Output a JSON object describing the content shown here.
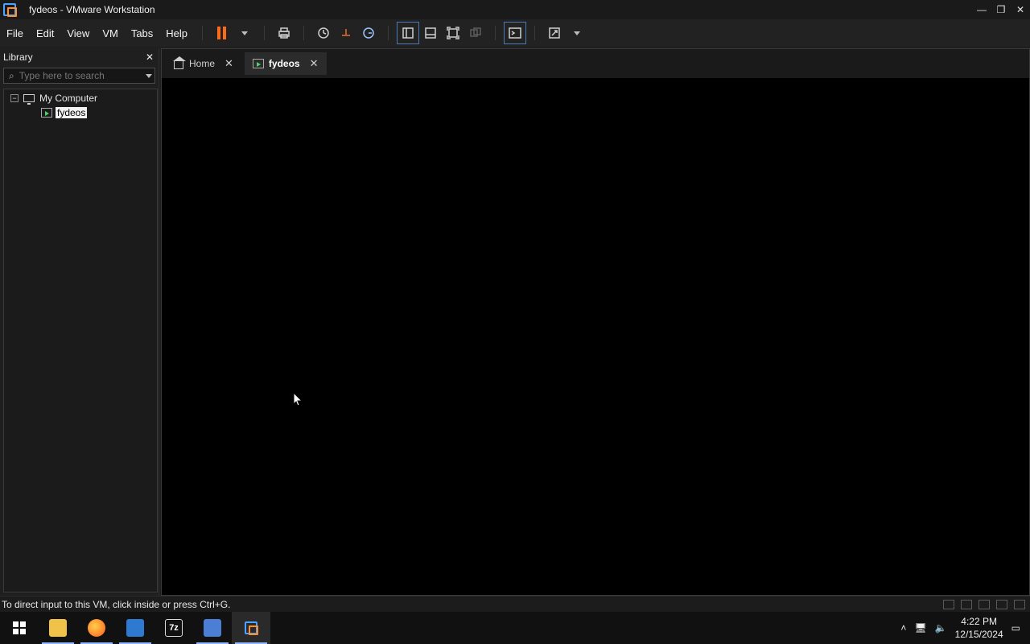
{
  "window": {
    "title": "fydeos - VMware Workstation"
  },
  "menu": {
    "items": [
      "File",
      "Edit",
      "View",
      "VM",
      "Tabs",
      "Help"
    ]
  },
  "library": {
    "title": "Library",
    "search_placeholder": "Type here to search",
    "tree": {
      "root_label": "My Computer",
      "vm_label": "fydeos"
    }
  },
  "tabs": [
    {
      "label": "Home"
    },
    {
      "label": "fydeos"
    }
  ],
  "status": {
    "message": "To direct input to this VM, click inside or press Ctrl+G."
  },
  "taskbar": {
    "time": "4:22 PM",
    "date": "12/15/2024"
  },
  "colors": {
    "accent_blue": "#4aa3ff",
    "accent_orange": "#ff6a1a",
    "vm_green": "#49d36b"
  },
  "icons": {
    "pause": "pause-icon",
    "home": "home-icon",
    "close": "close-icon",
    "search": "search-icon",
    "computer": "computer-icon",
    "vm": "vm-icon"
  }
}
